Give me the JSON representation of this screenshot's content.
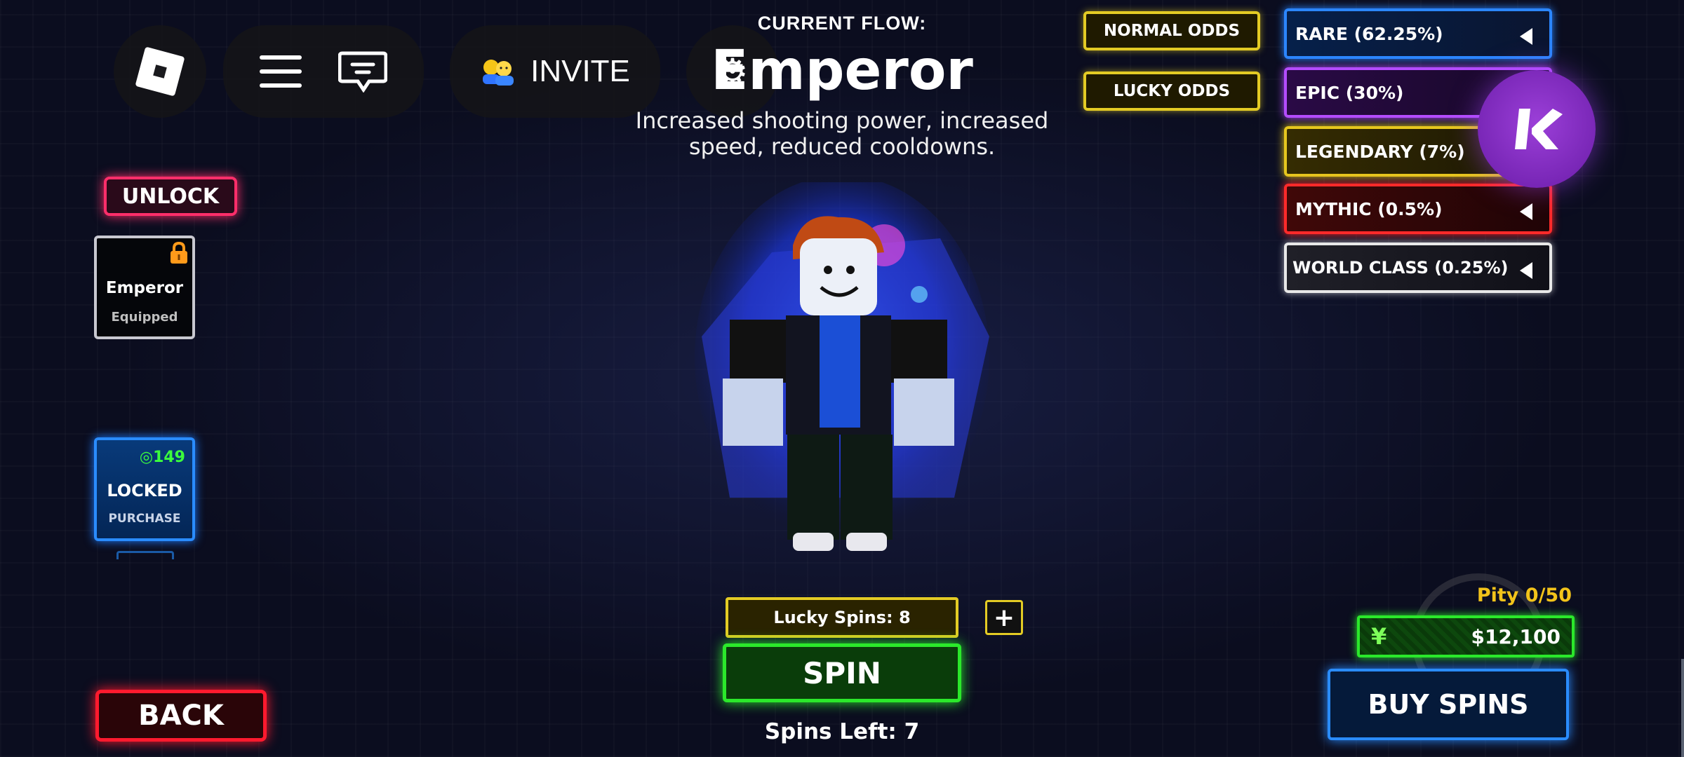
{
  "topbar": {
    "invite_label": "INVITE"
  },
  "flow": {
    "header": "CURRENT FLOW:",
    "name": "Emperor",
    "description": "Increased shooting power, increased speed, reduced cooldowns."
  },
  "left_panel": {
    "unlock_label": "UNLOCK",
    "equipped_card": {
      "name": "Emperor",
      "status": "Equipped"
    },
    "locked_card": {
      "price": "149",
      "name": "LOCKED",
      "action": "PURCHASE"
    },
    "back_label": "BACK"
  },
  "odds": {
    "normal_label": "NORMAL ODDS",
    "lucky_label": "LUCKY ODDS"
  },
  "rarities": [
    {
      "label": "RARE (62.25%)",
      "color": "#2b86ff"
    },
    {
      "label": "EPIC (30%)",
      "color": "#b44cff"
    },
    {
      "label": "LEGENDARY (7%)",
      "color": "#e6c71e"
    },
    {
      "label": "MYTHIC (0.5%)",
      "color": "#ff2a2a"
    },
    {
      "label": "WORLD CLASS (0.25%)",
      "color": "#e8e8e8"
    }
  ],
  "spin": {
    "lucky_spins_label": "Lucky Spins: 8",
    "plus_label": "+",
    "spin_label": "SPIN",
    "spins_left_label": "Spins Left: 7"
  },
  "shop": {
    "pity_label": "Pity 0/50",
    "currency_symbol": "¥",
    "money": "$12,100",
    "buy_label": "BUY SPINS"
  }
}
